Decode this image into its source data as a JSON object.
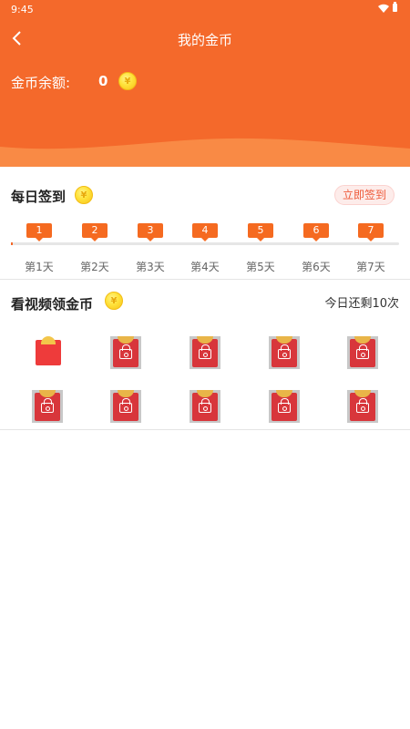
{
  "status_bar": {
    "time": "9:45"
  },
  "header": {
    "title": "我的金币",
    "balance_label": "金币余额:",
    "balance_value": "0"
  },
  "checkin": {
    "title": "每日签到",
    "button_label": "立即签到",
    "days": [
      {
        "number": "1",
        "label": "第1天"
      },
      {
        "number": "2",
        "label": "第2天"
      },
      {
        "number": "3",
        "label": "第3天"
      },
      {
        "number": "4",
        "label": "第4天"
      },
      {
        "number": "5",
        "label": "第5天"
      },
      {
        "number": "6",
        "label": "第6天"
      },
      {
        "number": "7",
        "label": "第7天"
      }
    ]
  },
  "video_rewards": {
    "title": "看视频领金币",
    "remaining_text": "今日还剩10次",
    "envelopes": [
      {
        "state": "unlocked"
      },
      {
        "state": "locked"
      },
      {
        "state": "locked"
      },
      {
        "state": "locked"
      },
      {
        "state": "locked"
      },
      {
        "state": "locked"
      },
      {
        "state": "locked"
      },
      {
        "state": "locked"
      },
      {
        "state": "locked"
      },
      {
        "state": "locked"
      }
    ]
  },
  "icons": {
    "coin": "coin-icon",
    "back": "back-arrow-icon",
    "lock": "lock-icon",
    "envelope": "red-envelope-icon"
  },
  "colors": {
    "brand": "#f4692b",
    "badge": "#f56a20",
    "envelope_red": "#d8363b",
    "coin_yellow": "#ffe23a"
  }
}
